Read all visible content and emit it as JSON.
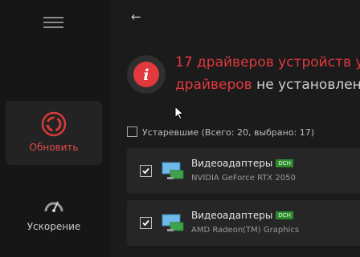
{
  "sidebar": {
    "items": [
      {
        "label": "Обновить"
      },
      {
        "label": "Ускорение"
      }
    ]
  },
  "alert": {
    "line1": "17 драйверов устройств у",
    "line2_red": "драйверов",
    "line2_rest": " не установлен"
  },
  "group": {
    "label": "Устаревшие (Всего: 20, выбрано: 17)"
  },
  "drivers": [
    {
      "category": "Видеоадаптеры",
      "badge": "DCH",
      "device": "NVIDIA GeForce RTX 2050"
    },
    {
      "category": "Видеоадаптеры",
      "badge": "DCH",
      "device": "AMD Radeon(TM) Graphics"
    }
  ],
  "colors": {
    "accent_red": "#e0393e",
    "badge_green": "#2e8b2e",
    "sidebar_bg": "#161616",
    "main_bg": "#1b1b1b"
  }
}
